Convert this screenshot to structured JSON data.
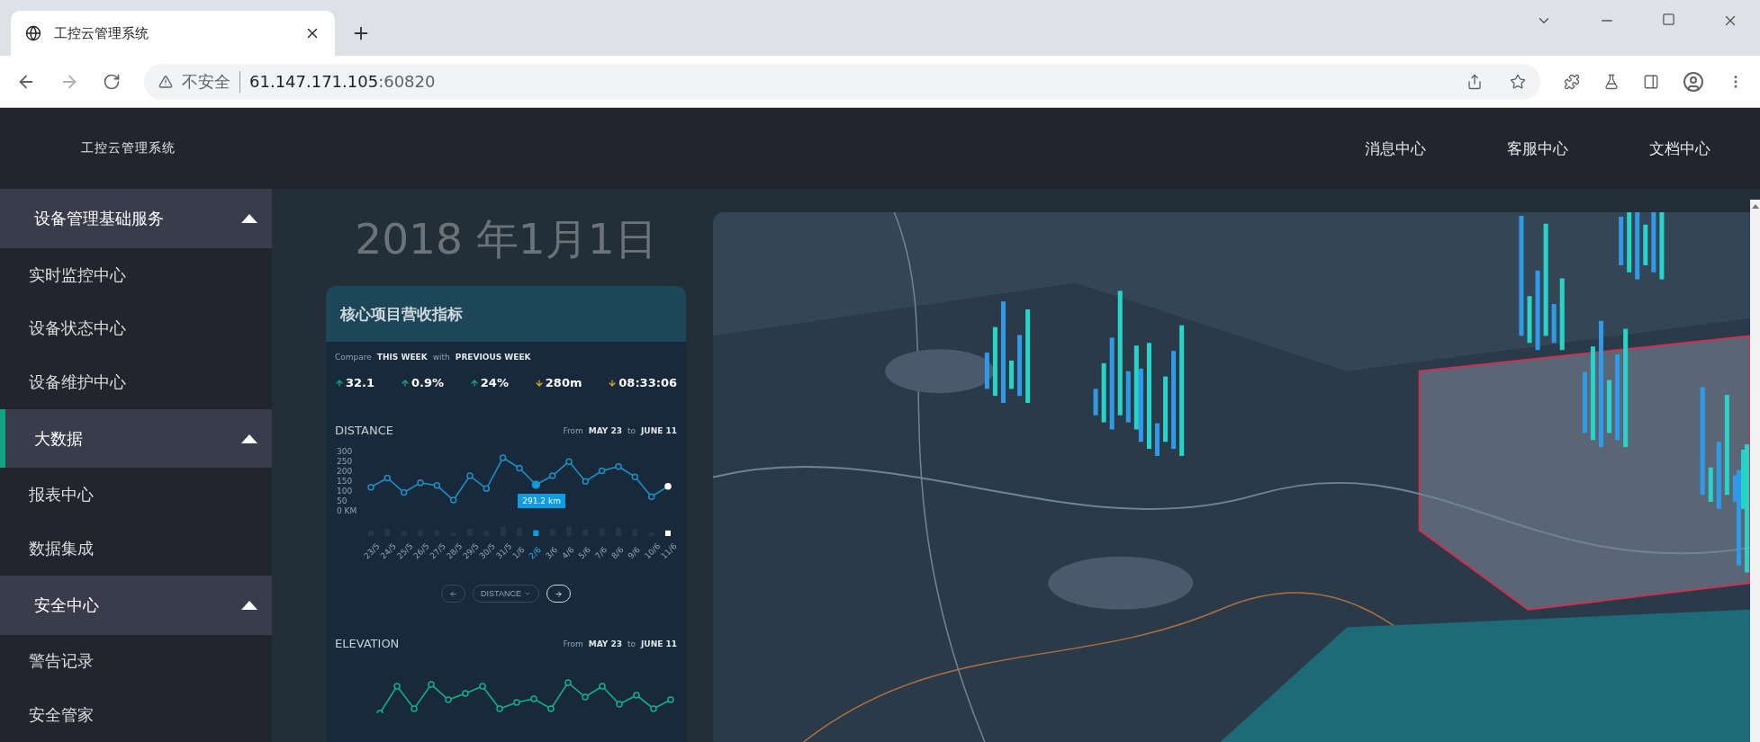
{
  "browser": {
    "tab_title": "工控云管理系统",
    "security": "不安全",
    "host": "61.147.171.105",
    "port": ":60820"
  },
  "header": {
    "brand": "工控云管理系统",
    "nav": [
      "消息中心",
      "客服中心",
      "文档中心"
    ]
  },
  "sidebar": [
    {
      "title": "设备管理基础服务",
      "expanded": true,
      "selected": false,
      "items": [
        "实时监控中心",
        "设备状态中心",
        "设备维护中心"
      ]
    },
    {
      "title": "大数据",
      "expanded": true,
      "selected": true,
      "items": [
        "报表中心",
        "数据集成"
      ]
    },
    {
      "title": "安全中心",
      "expanded": true,
      "selected": false,
      "items": [
        "警告记录",
        "安全管家"
      ]
    }
  ],
  "content": {
    "date": "2018 年1月1日",
    "card": {
      "title": "核心项目营收指标",
      "compare": {
        "label": "Compare",
        "current": "THIS WEEK",
        "joiner": "with",
        "previous": "PREVIOUS WEEK"
      },
      "stats": [
        {
          "value": "32.1",
          "kind": "up"
        },
        {
          "value": "0.9%",
          "kind": "up"
        },
        {
          "value": "24%",
          "kind": "up"
        },
        {
          "value": "280m",
          "kind": "down"
        },
        {
          "value": "08:33:06",
          "kind": "down"
        }
      ],
      "distance": {
        "heading": "DISTANCE",
        "from_label": "From",
        "from": "MAY 23",
        "to_label": "to",
        "to": "JUNE 11",
        "tooltip": "291.2 km",
        "dropdown": "DISTANCE",
        "chart_data": {
          "type": "line",
          "categories": [
            "23/5",
            "24/5",
            "25/5",
            "26/5",
            "27/5",
            "28/5",
            "29/5",
            "30/5",
            "31/5",
            "1/6",
            "2/6",
            "3/6",
            "4/6",
            "5/6",
            "7/6",
            "8/6",
            "9/6",
            "10/6",
            "11/6"
          ],
          "series": [
            {
              "color": "#1f8fc4",
              "marker": true,
              "values": [
                119,
                166,
                93,
                142,
                128,
                54,
                177,
                112,
                268,
                216,
                132,
                177,
                249,
                149,
                202,
                224,
                172,
                72,
                124
              ]
            }
          ],
          "ylim": [
            0,
            300
          ],
          "yticks": [
            {
              "value": 0,
              "label": "0 KM"
            },
            50,
            100,
            150,
            200,
            250,
            300
          ]
        }
      },
      "elevation": {
        "heading": "ELEVATION",
        "from_label": "From",
        "from": "MAY 23",
        "to_label": "to",
        "to": "JUNE 11"
      }
    }
  }
}
